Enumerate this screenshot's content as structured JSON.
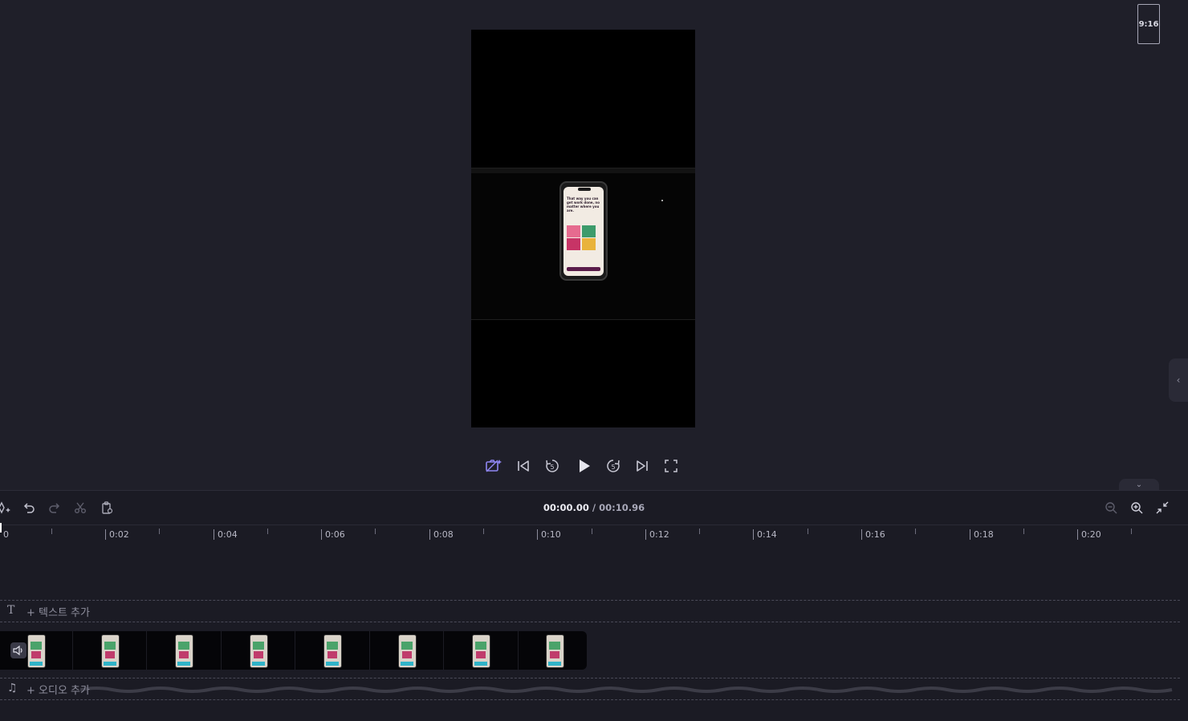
{
  "preview": {
    "aspect_ratio_label": "9:16",
    "phone_text": "That way you can get work done, no matter where you are."
  },
  "player": {
    "controls": [
      "ai-camera-icon",
      "skip-back-icon",
      "rewind-5-icon",
      "play-icon",
      "forward-5-icon",
      "skip-forward-icon",
      "fullscreen-icon"
    ],
    "rewind_label": "5",
    "forward_label": "5"
  },
  "timeline": {
    "current_time": "00:00.00",
    "separator": " / ",
    "total_time": "00:10.96",
    "ruler": [
      "0",
      "0:02",
      "0:04",
      "0:06",
      "0:08",
      "0:10",
      "0:12",
      "0:14",
      "0:16",
      "0:18",
      "0:20"
    ],
    "text_lane_label": "+ 텍스트 추가",
    "audio_lane_label": "+ 오디오 추가",
    "clip_thumbnail_count": 8
  },
  "colors": {
    "background": "#1f1f29",
    "timeline_bg": "#1b1b24",
    "accent": "#8f86f2"
  }
}
